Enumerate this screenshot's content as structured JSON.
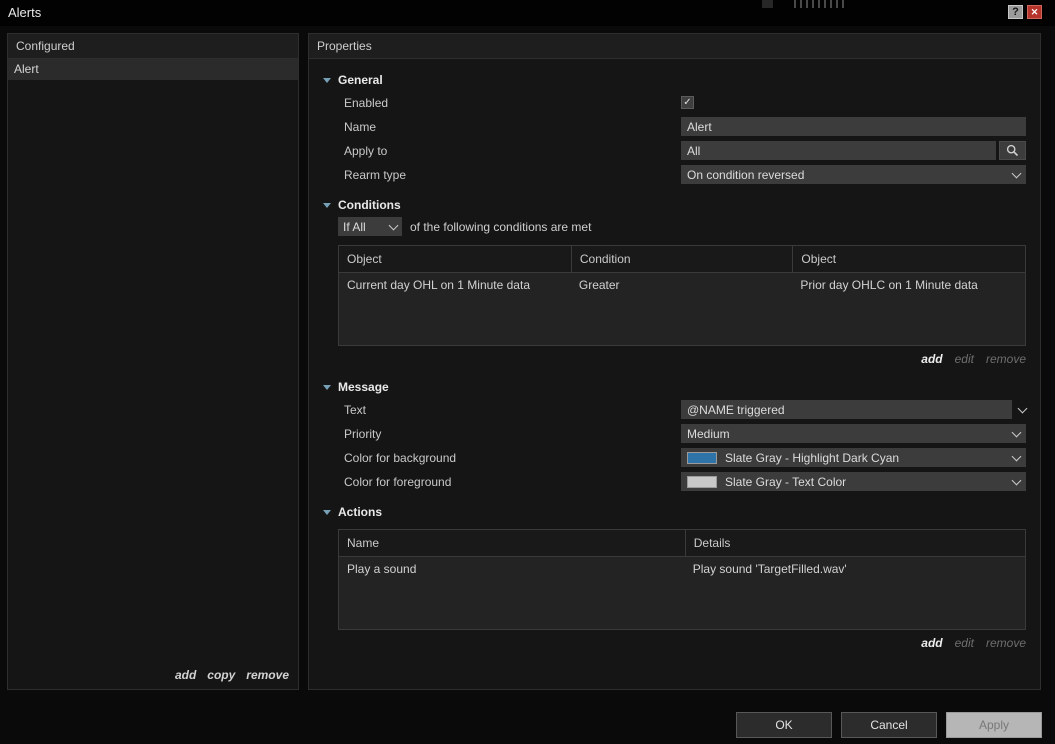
{
  "titlebar": {
    "title": "Alerts"
  },
  "icons": {
    "help": "?",
    "close": "✕",
    "check": "✓"
  },
  "configured_panel": {
    "header": "Configured",
    "items": [
      {
        "label": "Alert"
      }
    ],
    "links": {
      "add": "add",
      "copy": "copy",
      "remove": "remove"
    }
  },
  "properties_panel": {
    "header": "Properties",
    "general": {
      "title": "General",
      "enabled_label": "Enabled",
      "name_label": "Name",
      "name_value": "Alert",
      "apply_to_label": "Apply to",
      "apply_to_value": "All",
      "rearm_type_label": "Rearm type",
      "rearm_type_value": "On condition reversed"
    },
    "conditions": {
      "title": "Conditions",
      "match_selector_value": "If All",
      "match_suffix": "of the following conditions are met",
      "table": {
        "headers": [
          "Object",
          "Condition",
          "Object"
        ],
        "rows": [
          [
            "Current day OHL on 1 Minute data",
            "Greater",
            "Prior day OHLC on 1 Minute data"
          ]
        ]
      },
      "links": {
        "add": "add",
        "edit": "edit",
        "remove": "remove"
      }
    },
    "message": {
      "title": "Message",
      "text_label": "Text",
      "text_value": "@NAME triggered",
      "priority_label": "Priority",
      "priority_value": "Medium",
      "background_label": "Color for background",
      "background_value": "Slate Gray - Highlight Dark Cyan",
      "background_swatch": "#2e74a8",
      "foreground_label": "Color for foreground",
      "foreground_value": "Slate Gray - Text Color",
      "foreground_swatch": "#c8c8c8"
    },
    "actions": {
      "title": "Actions",
      "table": {
        "headers": [
          "Name",
          "Details"
        ],
        "rows": [
          [
            "Play a sound",
            "Play sound 'TargetFilled.wav'"
          ]
        ]
      },
      "links": {
        "add": "add",
        "edit": "edit",
        "remove": "remove"
      }
    }
  },
  "footer": {
    "ok": "OK",
    "cancel": "Cancel",
    "apply": "Apply"
  }
}
